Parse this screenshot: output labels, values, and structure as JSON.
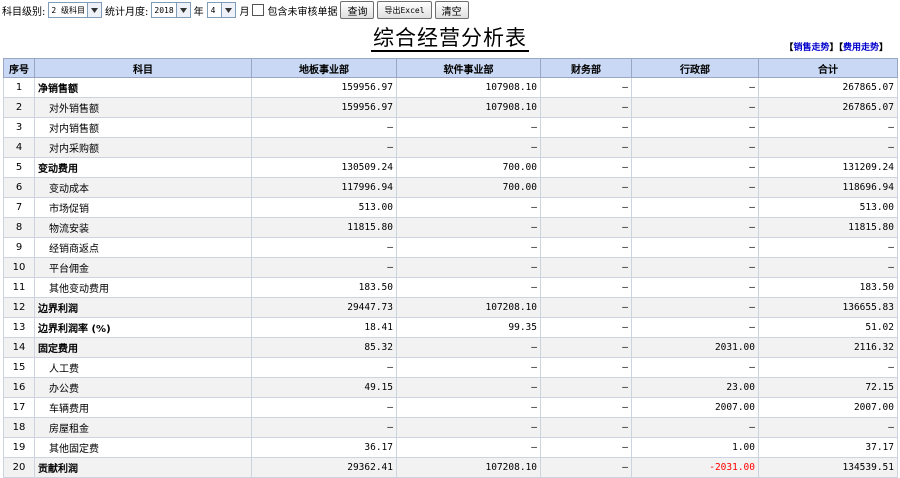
{
  "toolbar": {
    "level_label": "科目级别:",
    "level_value": "2 级科目",
    "period_label": "统计月度:",
    "year_value": "2018",
    "year_unit": "年",
    "month_value": "4",
    "month_unit": "月",
    "include_unreviewed_label": "包含未审核单据",
    "query_label": "查询",
    "export_label": "导出Excel",
    "clear_label": "清空"
  },
  "page_title": "综合经营分析表",
  "links": {
    "sales_trend": "销售走势",
    "expense_trend": "费用走势"
  },
  "table": {
    "headers": [
      "序号",
      "科目",
      "地板事业部",
      "软件事业部",
      "财务部",
      "行政部",
      "合计"
    ],
    "rows": [
      {
        "no": "1",
        "name": "净销售额",
        "bold": true,
        "cells": [
          "159956.97",
          "107908.10",
          "–",
          "–",
          "267865.07"
        ]
      },
      {
        "no": "2",
        "name": "对外销售额",
        "bold": false,
        "cells": [
          "159956.97",
          "107908.10",
          "–",
          "–",
          "267865.07"
        ]
      },
      {
        "no": "3",
        "name": "对内销售额",
        "bold": false,
        "cells": [
          "–",
          "–",
          "–",
          "–",
          "–"
        ]
      },
      {
        "no": "4",
        "name": "对内采购额",
        "bold": false,
        "cells": [
          "–",
          "–",
          "–",
          "–",
          "–"
        ]
      },
      {
        "no": "5",
        "name": "变动费用",
        "bold": true,
        "cells": [
          "130509.24",
          "700.00",
          "–",
          "–",
          "131209.24"
        ]
      },
      {
        "no": "6",
        "name": "变动成本",
        "bold": false,
        "cells": [
          "117996.94",
          "700.00",
          "–",
          "–",
          "118696.94"
        ]
      },
      {
        "no": "7",
        "name": "市场促销",
        "bold": false,
        "cells": [
          "513.00",
          "–",
          "–",
          "–",
          "513.00"
        ]
      },
      {
        "no": "8",
        "name": "物流安装",
        "bold": false,
        "cells": [
          "11815.80",
          "–",
          "–",
          "–",
          "11815.80"
        ]
      },
      {
        "no": "9",
        "name": "经销商返点",
        "bold": false,
        "cells": [
          "–",
          "–",
          "–",
          "–",
          "–"
        ]
      },
      {
        "no": "10",
        "name": "平台佣金",
        "bold": false,
        "cells": [
          "–",
          "–",
          "–",
          "–",
          "–"
        ]
      },
      {
        "no": "11",
        "name": "其他变动费用",
        "bold": false,
        "cells": [
          "183.50",
          "–",
          "–",
          "–",
          "183.50"
        ]
      },
      {
        "no": "12",
        "name": "边界利润",
        "bold": true,
        "cells": [
          "29447.73",
          "107208.10",
          "–",
          "–",
          "136655.83"
        ]
      },
      {
        "no": "13",
        "name": "边界利润率 (%)",
        "bold": true,
        "cells": [
          "18.41",
          "99.35",
          "–",
          "–",
          "51.02"
        ]
      },
      {
        "no": "14",
        "name": "固定费用",
        "bold": true,
        "cells": [
          "85.32",
          "–",
          "–",
          "2031.00",
          "2116.32"
        ]
      },
      {
        "no": "15",
        "name": "人工费",
        "bold": false,
        "cells": [
          "–",
          "–",
          "–",
          "–",
          "–"
        ]
      },
      {
        "no": "16",
        "name": "办公费",
        "bold": false,
        "cells": [
          "49.15",
          "–",
          "–",
          "23.00",
          "72.15"
        ]
      },
      {
        "no": "17",
        "name": "车辆费用",
        "bold": false,
        "cells": [
          "–",
          "–",
          "–",
          "2007.00",
          "2007.00"
        ]
      },
      {
        "no": "18",
        "name": "房屋租金",
        "bold": false,
        "cells": [
          "–",
          "–",
          "–",
          "–",
          "–"
        ]
      },
      {
        "no": "19",
        "name": "其他固定费",
        "bold": false,
        "cells": [
          "36.17",
          "–",
          "–",
          "1.00",
          "37.17"
        ]
      },
      {
        "no": "20",
        "name": "贡献利润",
        "bold": true,
        "cells": [
          "29362.41",
          "107208.10",
          "–",
          "-2031.00",
          "134539.51"
        ]
      }
    ]
  },
  "colors": {
    "header_bg": "#c9d8f4",
    "link": "#0000cc",
    "negative": "#ff0000"
  }
}
